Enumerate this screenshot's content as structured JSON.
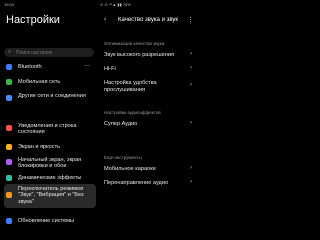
{
  "status": {
    "time": "15:04",
    "right": "⊙ ⊖ ⁴⁶▲ ▮▮ 76%"
  },
  "left": {
    "title": "Настройки",
    "search_placeholder": "Поиск настроек",
    "items": [
      {
        "label": "Bluetooth",
        "color": "#3d7bff",
        "tail": "—"
      },
      {
        "label": "Мобильная сеть",
        "color": "#39b54a",
        "tail": ""
      },
      {
        "label": "Другие сети и соединения",
        "color": "#4a8bff",
        "tail": ""
      },
      {
        "label": "Уведомления и строка состояния",
        "color": "#ff4d4d",
        "tail": ""
      },
      {
        "label": "Экран и яркость",
        "color": "#ffb020",
        "tail": ""
      },
      {
        "label": "Начальный экран, экран блокировки и обои",
        "color": "#b05cff",
        "tail": ""
      },
      {
        "label": "Динамические эффекты",
        "color": "#2fbf9f",
        "tail": ""
      },
      {
        "label": "Переключатель режимов \"Звук\", \"Вибрация\" и \"Без звука\"",
        "color": "#ff9a1f",
        "tail": ""
      },
      {
        "label": "Обновление системы",
        "color": "#3d7bff",
        "tail": ""
      }
    ]
  },
  "right": {
    "title": "Качество звука и звук…",
    "sections": [
      {
        "header": "Оптимизация качества звука",
        "rows": [
          "Звук высокого разрешения",
          "Hi-Fi",
          "Настройка удобства прослушивания"
        ]
      },
      {
        "header": "Настройки аудиоэффектов",
        "rows": [
          "Супер Аудио"
        ]
      },
      {
        "header": "Еще инструменты",
        "rows": [
          "Мобильное караоке",
          "Перенаправление аудио"
        ]
      }
    ]
  }
}
